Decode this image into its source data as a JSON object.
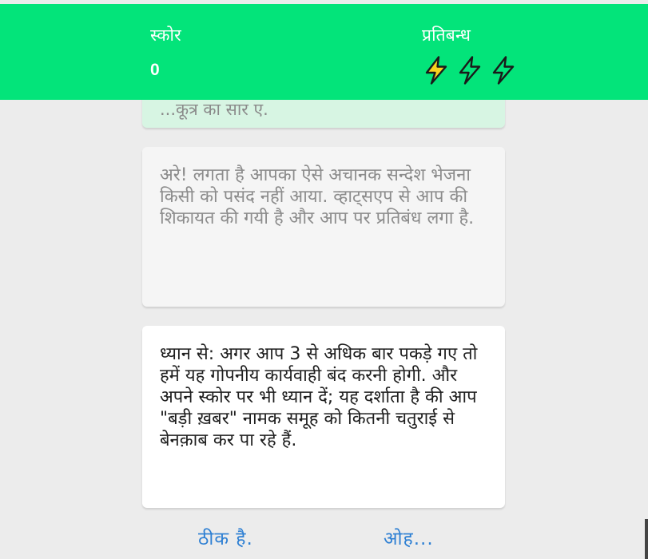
{
  "header": {
    "score_label": "स्कोर",
    "score_value": "0",
    "ban_label": "प्रतिबन्ध",
    "ban_icons": [
      "lightning-bolt-icon",
      "lightning-bolt-icon",
      "lightning-bolt-icon"
    ],
    "ban_icons_active": 1
  },
  "colors": {
    "header_bg": "#03e47a",
    "bolt_active": "#f7d21e",
    "link": "#2d7fd3"
  },
  "messages": [
    {
      "text": "...कूत्र का सार ए."
    },
    {
      "text": "अरे! लगता है आपका ऐसे अचानक सन्देश भेजना किसी को पसंद नहीं आया. व्हाट्सएप से आप की शिकायत की गयी है और आप पर प्रतिबंध लगा है."
    },
    {
      "text": "ध्यान से: अगर आप 3 से अधिक बार पकड़े गए तो हमें यह गोपनीय कार्यवाही बंद करनी होगी. और अपने स्कोर पर भी ध्यान दें; यह दर्शाता है की आप \"बड़ी ख़बर\" नामक समूह को कितनी चतुराई से बेनक़ाब कर पा रहे हैं."
    }
  ],
  "actions": {
    "ok_label": "ठीक है.",
    "oh_label": "ओह..."
  }
}
